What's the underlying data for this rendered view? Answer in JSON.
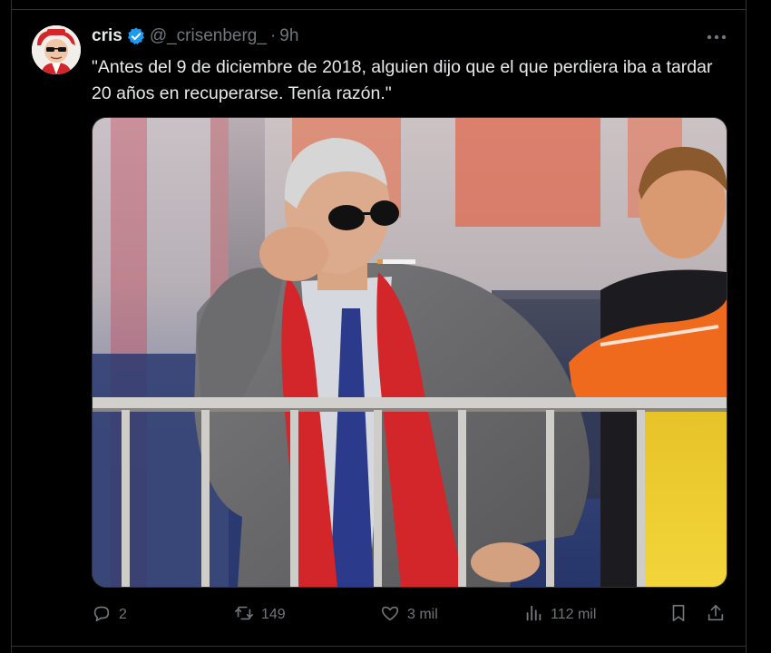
{
  "tweet": {
    "author_name": "cris",
    "handle": "@_crisenberg_",
    "separator": "·",
    "time": "9h",
    "text": "\"Antes del 9 de diciembre de 2018, alguien dijo que el que perdiera iba a tardar 20 años en recuperarse. Tenía razón.\""
  },
  "icons": {
    "verified": "verified-badge-icon",
    "more": "more-dots-icon",
    "reply": "reply-icon",
    "retweet": "retweet-icon",
    "like": "heart-icon",
    "views": "views-icon",
    "bookmark": "bookmark-icon",
    "share": "share-icon"
  },
  "actions": {
    "replies": "2",
    "retweets": "149",
    "likes": "3 mil",
    "views": "112 mil"
  },
  "colors": {
    "background": "#000000",
    "text": "#e7e9ea",
    "muted": "#71767b",
    "verified_blue": "#1d9bf0",
    "scarf_red": "#d3262a"
  }
}
